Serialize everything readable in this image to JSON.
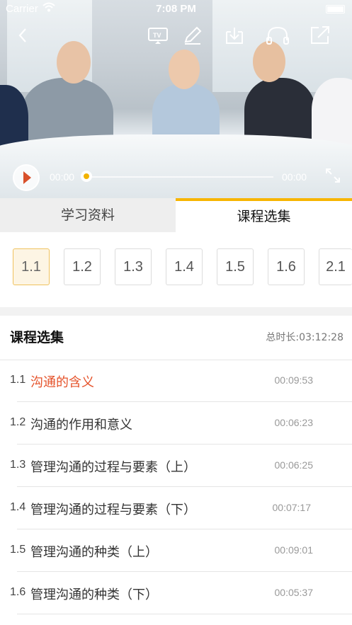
{
  "status_bar": {
    "carrier": "Carrier",
    "time": "7:08 PM"
  },
  "player": {
    "current_time": "00:00",
    "total_time": "00:00",
    "progress": 0,
    "icons": [
      "back-icon",
      "tv-cast-icon",
      "pencil-icon",
      "download-icon",
      "headphones-icon",
      "share-icon",
      "play-icon",
      "fullscreen-icon"
    ],
    "accent_color": "#f2b300"
  },
  "tabs": [
    {
      "label": "学习资料",
      "active": false
    },
    {
      "label": "课程选集",
      "active": true
    }
  ],
  "chips": [
    "1.1",
    "1.2",
    "1.3",
    "1.4",
    "1.5",
    "1.6",
    "2.1"
  ],
  "selected_chip": "1.1",
  "episode_list": {
    "title": "课程选集",
    "total_duration": "总时长:03:12:28",
    "items": [
      {
        "num": "1.1",
        "title": "沟通的含义",
        "duration": "00:09:53",
        "active": true
      },
      {
        "num": "1.2",
        "title": "沟通的作用和意义",
        "duration": "00:06:23",
        "active": false
      },
      {
        "num": "1.3",
        "title": "管理沟通的过程与要素（上）",
        "duration": "00:06:25",
        "active": false
      },
      {
        "num": "1.4",
        "title": "管理沟通的过程与要素（下）",
        "duration": "00:07:17",
        "active": false
      },
      {
        "num": "1.5",
        "title": "管理沟通的种类（上）",
        "duration": "00:09:01",
        "active": false
      },
      {
        "num": "1.6",
        "title": "管理沟通的种类（下）",
        "duration": "00:05:37",
        "active": false
      }
    ]
  },
  "colors": {
    "active_title": "#e5522a",
    "tab_indicator": "#f7b500",
    "chip_active_bg": "#fdf5e4"
  }
}
